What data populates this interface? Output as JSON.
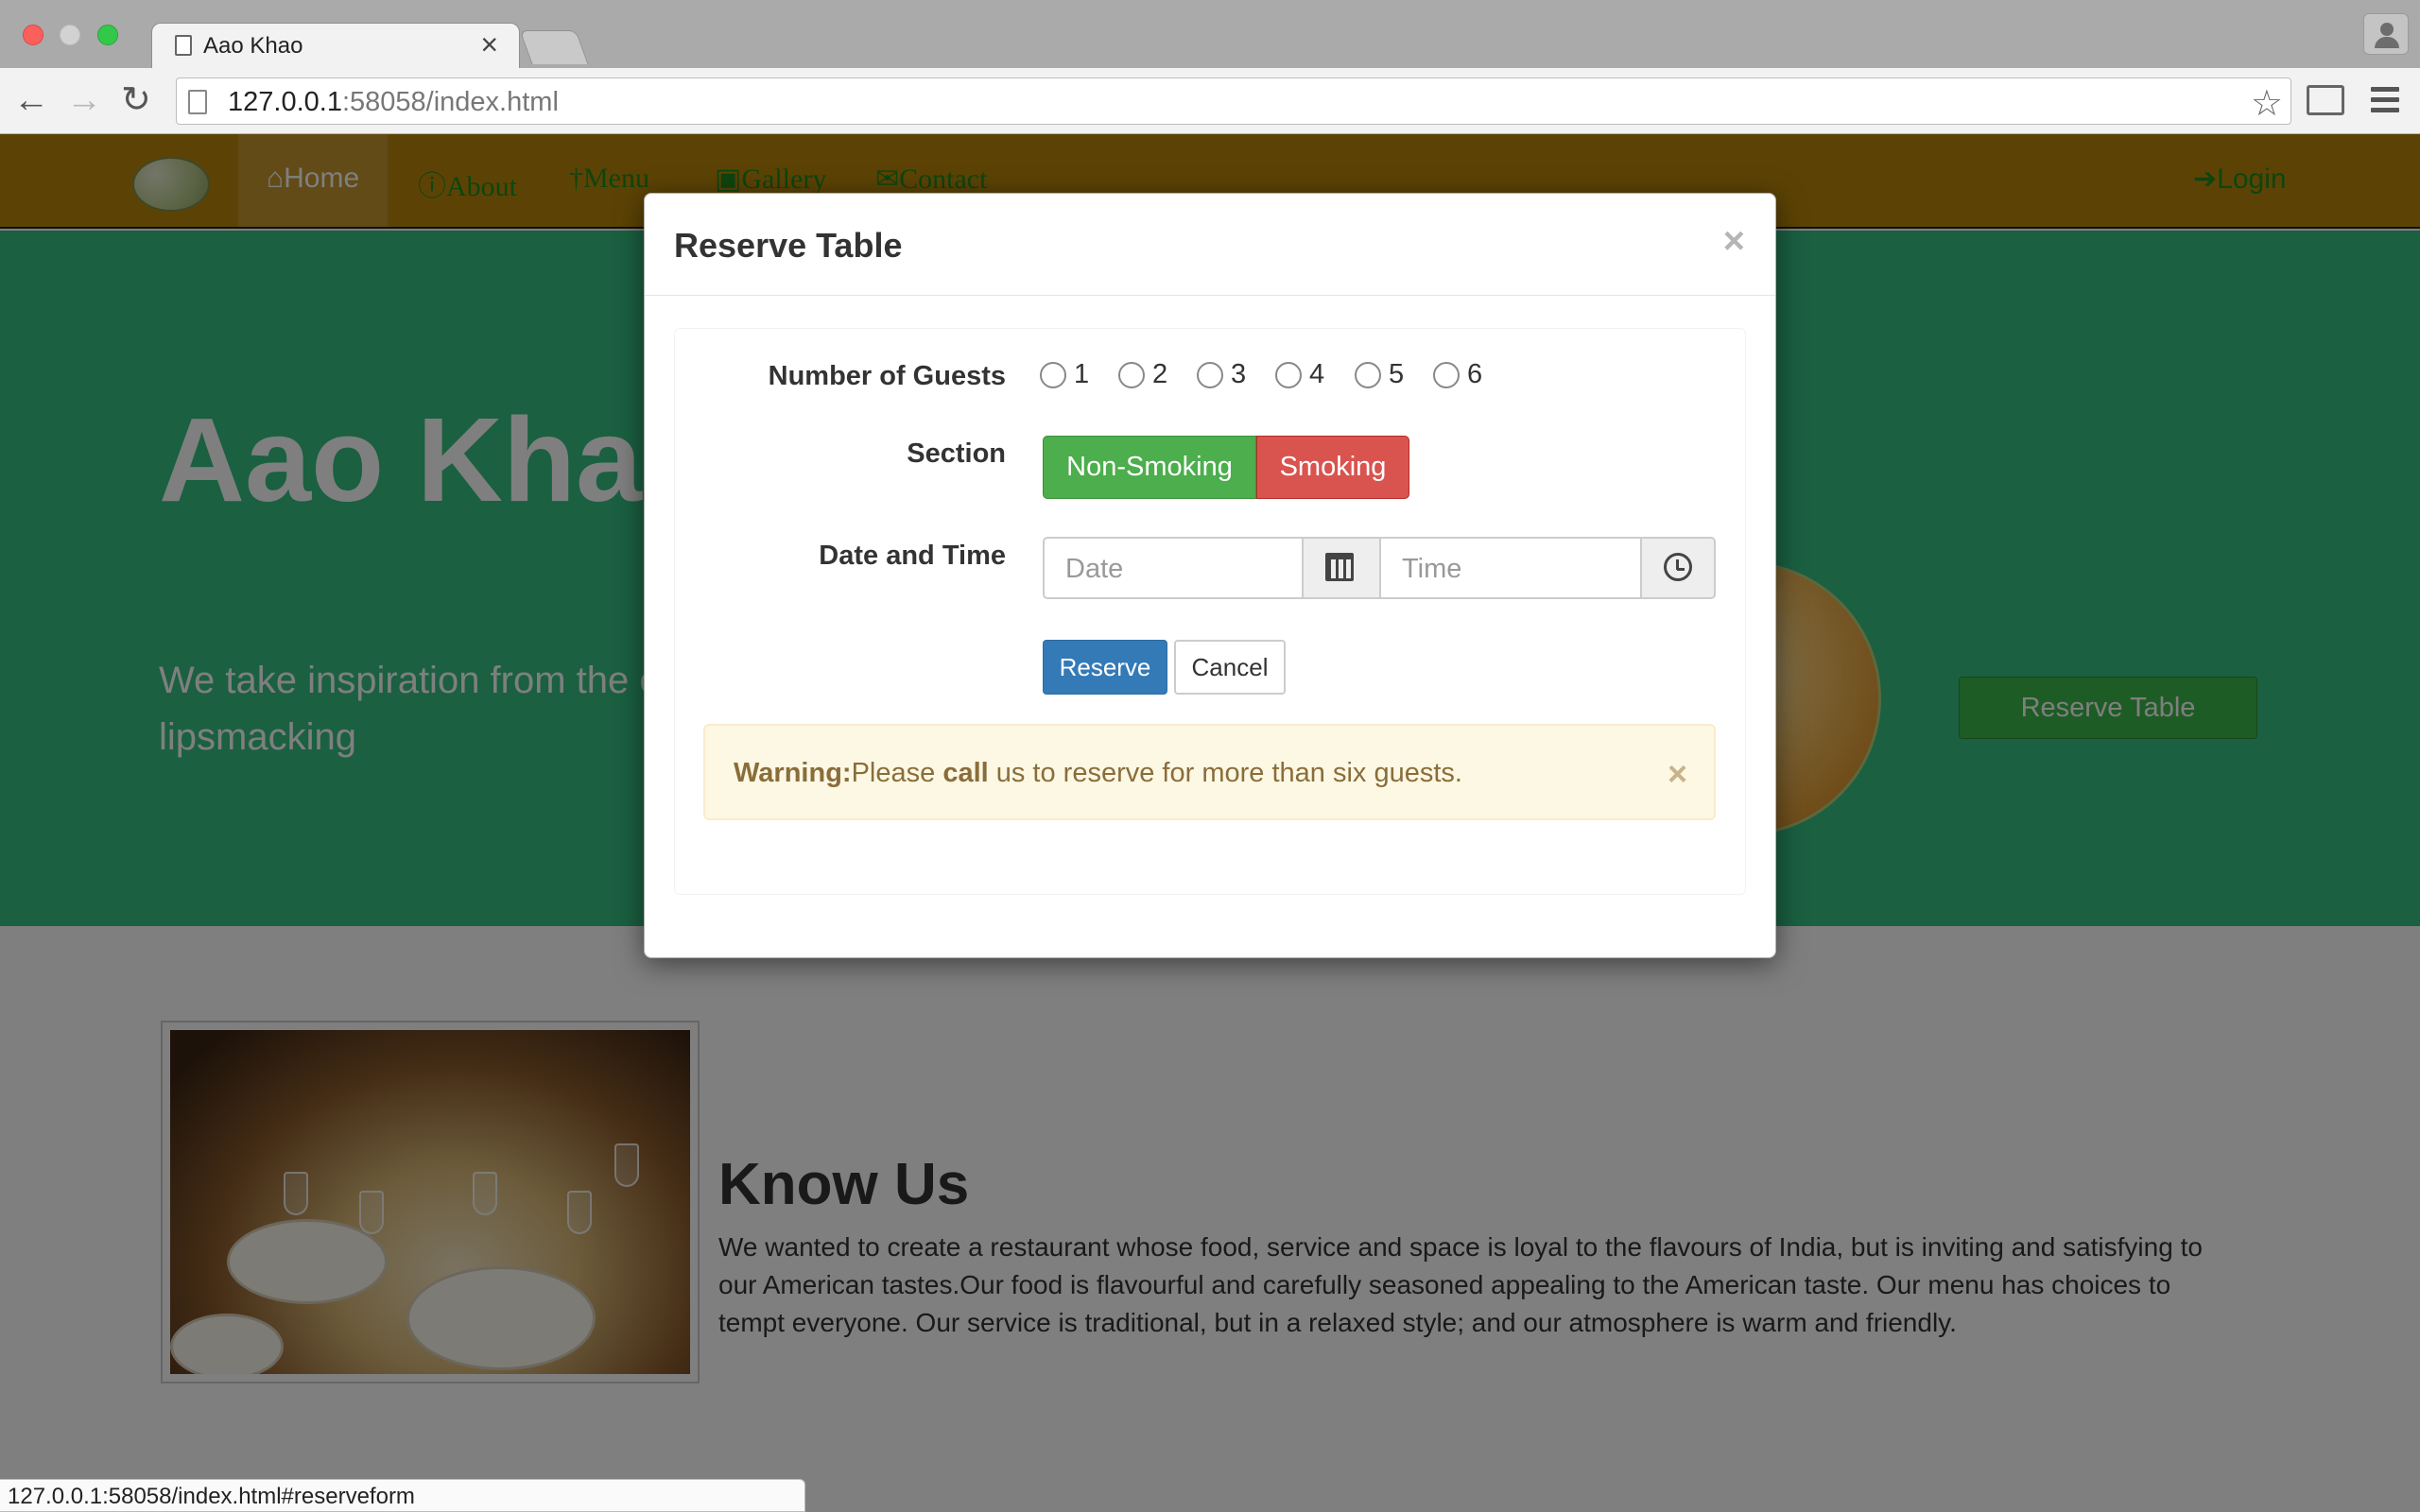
{
  "browser": {
    "tab_title": "Aao Khao",
    "tab_close": "×",
    "url_host": "127.0.0.1",
    "url_rest": ":58058/index.html",
    "status_url": "127.0.0.1:58058/index.html#reserveform"
  },
  "nav": {
    "items": [
      {
        "label": "Home",
        "icon": "home-icon"
      },
      {
        "label": "About",
        "icon": "info-icon"
      },
      {
        "label": "Menu",
        "icon": "cutlery-icon"
      },
      {
        "label": "Gallery",
        "icon": "picture-icon"
      },
      {
        "label": "Contact",
        "icon": "envelope-icon"
      }
    ],
    "login": "Login"
  },
  "hero": {
    "title": "Aao Khao",
    "text": "We take inspiration from the experience. Our lipsmacking",
    "reserve_button": "Reserve Table"
  },
  "knowus": {
    "title": "Know Us",
    "text": "We wanted to create a restaurant whose food, service and space is loyal to the flavours of India, but is inviting and satisfying to our American tastes.Our food is flavourful and carefully seasoned appealing to the American taste. Our menu has choices to tempt everyone. Our service is traditional, but in a relaxed style; and our atmosphere is warm and friendly."
  },
  "modal": {
    "title": "Reserve Table",
    "close": "×",
    "guests_label": "Number of Guests",
    "guest_options": [
      "1",
      "2",
      "3",
      "4",
      "5",
      "6"
    ],
    "section_label": "Section",
    "section_options": [
      "Non-Smoking",
      "Smoking"
    ],
    "datetime_label": "Date and Time",
    "date_placeholder": "Date",
    "time_placeholder": "Time",
    "reserve_button": "Reserve",
    "cancel_button": "Cancel",
    "warning_strong": "Warning:",
    "warning_pre": "Please ",
    "warning_bold": "call",
    "warning_post": " us to reserve for more than six guests.",
    "warning_close": "×"
  },
  "colors": {
    "nav_bg": "#b8860b",
    "hero_bg": "#34c083",
    "success": "#4cae4c",
    "danger": "#d9534f",
    "primary": "#337ab7",
    "warning_bg": "#fcf8e3"
  }
}
